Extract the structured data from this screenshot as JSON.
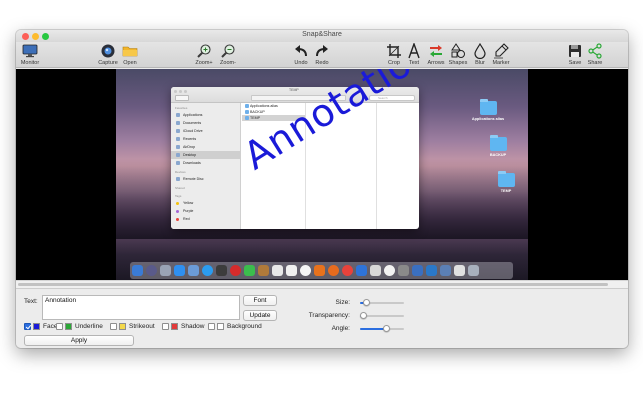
{
  "window": {
    "title": "Snap&Share"
  },
  "toolbar": {
    "monitor": "Monitor",
    "capture": "Capture",
    "open": "Open",
    "zoom_in": "Zoom+",
    "zoom_out": "Zoom-",
    "undo": "Undo",
    "redo": "Redo",
    "crop": "Crop",
    "text": "Text",
    "arrows": "Arrows",
    "shapes": "Shapes",
    "blur": "Blur",
    "marker": "Marker",
    "save": "Save",
    "share": "Share"
  },
  "screenshot": {
    "annotation_text": "Annotation",
    "finder": {
      "title": "TEMP",
      "search_placeholder": "Search",
      "favorites_header": "Favorites",
      "favorites": [
        "Applications",
        "Documents",
        "iCloud Drive",
        "Recents",
        "AirDrop",
        "Desktop",
        "Downloads"
      ],
      "selected_favorite": "Desktop",
      "devices_header": "Devices",
      "devices": [
        "Remote Disc"
      ],
      "shared_header": "Shared",
      "tags_header": "Tags",
      "tags": [
        "Yellow",
        "Purple",
        "Red"
      ],
      "column_items": [
        "Applications alias",
        "BACKUP",
        "TEMP"
      ],
      "selected_column_item": "TEMP"
    },
    "desktop_icons": [
      "Applications alias",
      "BACKUP",
      "TEMP"
    ]
  },
  "panel": {
    "text_label": "Text:",
    "text_value": "Annotation",
    "font_button": "Font",
    "update_button": "Update",
    "apply_button": "Apply",
    "options": {
      "face": "Face",
      "underline": "Underline",
      "strikeout": "Strikeout",
      "shadow": "Shadow",
      "background": "Background"
    },
    "face_checked": true,
    "colors": {
      "face": "#1a1ad8",
      "underline": "#2aa836",
      "strikeout": "#f3d84a",
      "shadow": "#e23a3a",
      "accent": "#2b6ee0"
    },
    "size_label": "Size:",
    "size_value": 0.15,
    "transparency_label": "Transparency:",
    "transparency_value": 0.02,
    "angle_label": "Angle:",
    "angle_value": 0.6
  }
}
